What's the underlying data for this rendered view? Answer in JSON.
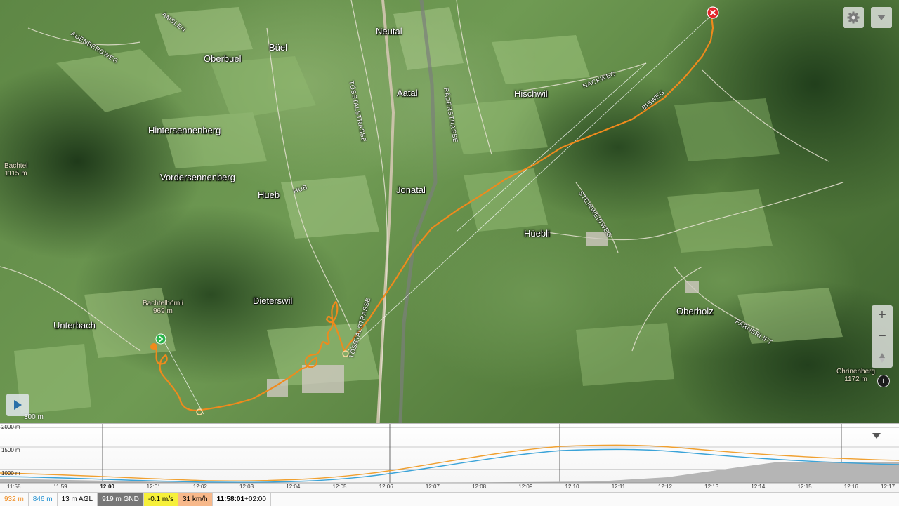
{
  "map": {
    "places": [
      {
        "id": "oberbuel",
        "label": "Oberbuel"
      },
      {
        "id": "buel",
        "label": "Büel"
      },
      {
        "id": "neutal",
        "label": "Neutal"
      },
      {
        "id": "aatal",
        "label": "Aatal"
      },
      {
        "id": "hischwil",
        "label": "Hischwil"
      },
      {
        "id": "hintersennenberg",
        "label": "Hintersennenberg"
      },
      {
        "id": "vordersennenberg",
        "label": "Vordersennenberg"
      },
      {
        "id": "hueb",
        "label": "Hueb"
      },
      {
        "id": "jonatal",
        "label": "Jonatal"
      },
      {
        "id": "huebli",
        "label": "Hüebli"
      },
      {
        "id": "dieterswil",
        "label": "Dieterswil"
      },
      {
        "id": "unterbach",
        "label": "Unterbach"
      },
      {
        "id": "oberholz",
        "label": "Oberholz"
      }
    ],
    "streets": [
      {
        "id": "amslen",
        "label": "AMSLEN"
      },
      {
        "id": "auenbergweg",
        "label": "AUENBERGWEG"
      },
      {
        "id": "tosstalstrasse_n",
        "label": "TÖSSTALSTRASSE"
      },
      {
        "id": "raderstrasse",
        "label": "RÄDERSTRASSE"
      },
      {
        "id": "nackweg",
        "label": "NACKWEG"
      },
      {
        "id": "bisweg",
        "label": "BISWEG"
      },
      {
        "id": "hub",
        "label": "HUB"
      },
      {
        "id": "steinweidweg",
        "label": "STEINWEIDWEG"
      },
      {
        "id": "tosstalstrasse_s",
        "label": "TÖSSTALSTRASSE"
      },
      {
        "id": "farnerlift",
        "label": "FARNERLIFT"
      }
    ],
    "peaks": [
      {
        "id": "bachtel",
        "name": "Bachtel",
        "elevation": "1115 m"
      },
      {
        "id": "bachtelhornli",
        "name": "Bachtelhörnli",
        "elevation": "969 m"
      },
      {
        "id": "chrinenberg",
        "name": "Chrinenberg",
        "elevation": "1172 m"
      }
    ],
    "scale_label": "300 m",
    "track_color": "#f08a1c",
    "icons": {
      "settings": "gear-icon",
      "collapse": "chevron-down-icon",
      "zoom_in": "plus-icon",
      "zoom_out": "minus-icon",
      "compass": "compass-icon",
      "info": "info-icon",
      "play": "play-icon",
      "start": "start-marker-icon",
      "end": "end-marker-icon"
    },
    "zoom": {
      "in": "+",
      "out": "−"
    },
    "info_symbol": "i"
  },
  "profile": {
    "y_labels": [
      "2000 m",
      "1500 m",
      "1000 m"
    ],
    "time_ticks": [
      "11:58",
      "11:59",
      "12:00",
      "12:01",
      "12:02",
      "12:03",
      "12:04",
      "12:05",
      "12:06",
      "12:07",
      "12:08",
      "12:09",
      "12:10",
      "12:11",
      "12:12",
      "12:13",
      "12:14",
      "12:15",
      "12:16",
      "12:17"
    ],
    "current_tick": "12:00",
    "altitude_color": "#f0a030",
    "ground_color": "#3aa3d8"
  },
  "status": {
    "altitude": "932 m",
    "altitude_color": "#f08a1c",
    "ground_altitude": "846 m",
    "ground_color": "#1e8fd0",
    "agl": "13 m AGL",
    "gnd": "919 m GND",
    "vario": "-0.1 m/s",
    "vario_bg": "#f6f03a",
    "speed": "31 km/h",
    "speed_bg": "#f7b88a",
    "time": "11:58:01",
    "timezone": "+02:00"
  }
}
